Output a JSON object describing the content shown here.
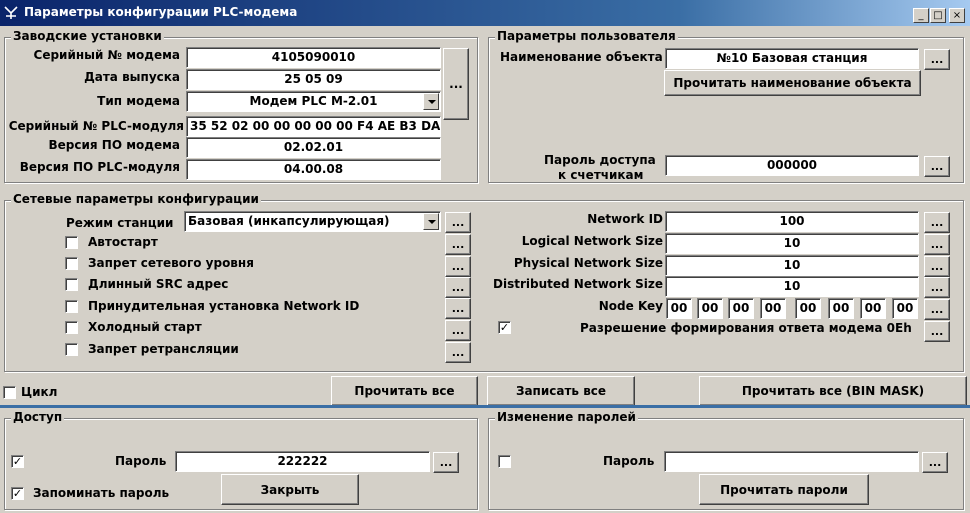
{
  "window": {
    "title": "Параметры конфигурации PLC-модема",
    "min_glyph": "_",
    "max_glyph": "□",
    "close_glyph": "×"
  },
  "factory": {
    "title": "Заводские установки",
    "rows": [
      {
        "label": "Серийный № модема",
        "value": "4105090010"
      },
      {
        "label": "Дата выпуска",
        "value": "25 05 09"
      },
      {
        "label": "Тип модема",
        "value": "Модем PLC M-2.01"
      },
      {
        "label": "Серийный № PLC-модуля",
        "value": "35 52 02 00 00 00 00 00 F4 AE B3 DA"
      },
      {
        "label": "Версия ПО модема",
        "value": "02.02.01"
      },
      {
        "label": "Версия ПО PLC-модуля",
        "value": "04.00.08"
      }
    ],
    "dots": "..."
  },
  "user_params": {
    "title": "Параметры пользователя",
    "object_name_label": "Наименование объекта",
    "object_name_value": "№10 Базовая станция",
    "read_name_button": "Прочитать наименование объекта",
    "password_label_1": "Пароль доступа",
    "password_label_2": "к счетчикам",
    "password_value": "000000"
  },
  "network": {
    "title": "Сетевые параметры конфигурации",
    "station_mode_label": "Режим станции",
    "station_mode_value": "Базовая (инкапсулирующая)",
    "checkboxes": [
      {
        "label": "Автостарт",
        "checked": false
      },
      {
        "label": "Запрет сетевого уровня",
        "checked": false
      },
      {
        "label": "Длинный SRC адрес",
        "checked": false
      },
      {
        "label": "Принудительная установка Network ID",
        "checked": false
      },
      {
        "label": "Холодный старт",
        "checked": false
      },
      {
        "label": "Запрет ретрансляции",
        "checked": false
      }
    ],
    "fields": [
      {
        "label": "Network ID",
        "value": "100"
      },
      {
        "label": "Logical Network Size",
        "value": "10"
      },
      {
        "label": "Physical Network Size",
        "value": "10"
      },
      {
        "label": "Distributed Network Size",
        "value": "10"
      }
    ],
    "node_key_label": "Node Key",
    "node_key": [
      "00",
      "00",
      "00",
      "00",
      "00",
      "00",
      "00",
      "00"
    ],
    "response_label": "Разрешение формирования ответа модема 0Eh",
    "response_checked": true
  },
  "toolbar": {
    "cycle_label": "Цикл",
    "cycle_checked": false,
    "read_all": "Прочитать все",
    "write_all": "Записать все",
    "read_all_bin": "Прочитать все (BIN MASK)"
  },
  "access": {
    "title": "Доступ",
    "password_label": "Пароль",
    "password_value": "222222",
    "password_checked": true,
    "remember_label": "Запоминать пароль",
    "remember_checked": true,
    "close_button": "Закрыть"
  },
  "passwords": {
    "title": "Изменение паролей",
    "password_label": "Пароль",
    "password_value": "",
    "checked": false,
    "read_button": "Прочитать пароли"
  },
  "check_glyph": "✓",
  "colors": {
    "titlebar_start": "#0a246a",
    "face": "#d4d0c8",
    "separator": "#3a6ea5"
  }
}
